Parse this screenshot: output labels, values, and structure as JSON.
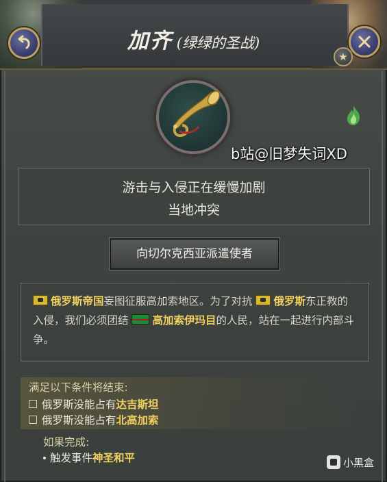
{
  "header": {
    "title": "加齐",
    "subtitle": "(绿绿的圣战)",
    "back_button_icon": "back-arrow-icon",
    "close_button_icon": "close-icon",
    "favorite_icon": "star-icon"
  },
  "icons": {
    "emblem": "bugle-horn-icon",
    "flame": "green-flame-icon"
  },
  "watermark": "b站@旧梦失词XD",
  "description": {
    "line1": "游击与入侵正在缓慢加剧",
    "line2": "当地冲突"
  },
  "action_button": "向切尔克西亚派遣使者",
  "info": {
    "country1": "俄罗斯帝国",
    "text1": "妄图征服高加索地区。为了对抗",
    "country2": "俄罗斯",
    "text2": "东正教的入侵，我们必须团结",
    "country3": "高加索伊玛目",
    "text3": "的人民，站在一起进行内部斗争。"
  },
  "conditions": {
    "title": "满足以下条件将结束:",
    "items": [
      {
        "prefix": "俄罗斯没能占有",
        "target": "达吉斯坦"
      },
      {
        "prefix": "俄罗斯没能占有",
        "target": "北高加索"
      }
    ]
  },
  "on_complete": {
    "title": "如果完成:",
    "prefix": "触发事件",
    "event": "神圣和平"
  },
  "site_mark": "小黑盒",
  "colors": {
    "highlight": "#f0d060",
    "text": "#d8d6cc",
    "background": "#3f4441",
    "accent_gold": "#b8a06a"
  }
}
